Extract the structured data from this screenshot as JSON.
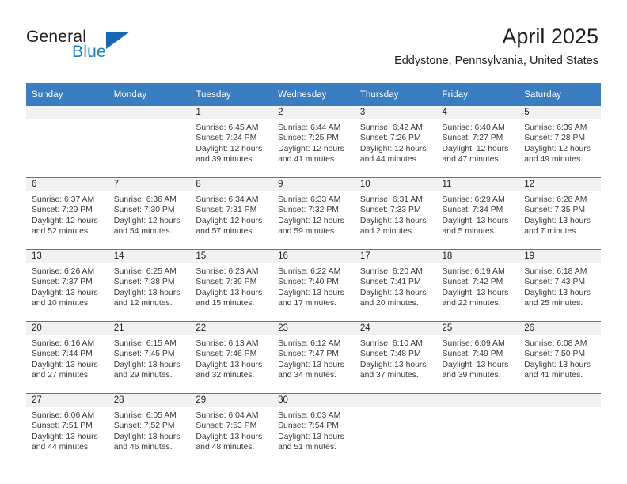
{
  "brand": {
    "name_part1": "General",
    "name_part2": "Blue",
    "accent_color": "#1668b2",
    "text_color": "#231f20"
  },
  "header": {
    "month_title": "April 2025",
    "location": "Eddystone, Pennsylvania, United States"
  },
  "calendar": {
    "header_bg": "#3a7dc0",
    "daynum_bg": "#f1f1f1",
    "weekdays": [
      "Sunday",
      "Monday",
      "Tuesday",
      "Wednesday",
      "Thursday",
      "Friday",
      "Saturday"
    ],
    "weeks": [
      [
        {
          "day": ""
        },
        {
          "day": ""
        },
        {
          "day": "1",
          "sunrise": "Sunrise: 6:45 AM",
          "sunset": "Sunset: 7:24 PM",
          "daylight": "Daylight: 12 hours and 39 minutes."
        },
        {
          "day": "2",
          "sunrise": "Sunrise: 6:44 AM",
          "sunset": "Sunset: 7:25 PM",
          "daylight": "Daylight: 12 hours and 41 minutes."
        },
        {
          "day": "3",
          "sunrise": "Sunrise: 6:42 AM",
          "sunset": "Sunset: 7:26 PM",
          "daylight": "Daylight: 12 hours and 44 minutes."
        },
        {
          "day": "4",
          "sunrise": "Sunrise: 6:40 AM",
          "sunset": "Sunset: 7:27 PM",
          "daylight": "Daylight: 12 hours and 47 minutes."
        },
        {
          "day": "5",
          "sunrise": "Sunrise: 6:39 AM",
          "sunset": "Sunset: 7:28 PM",
          "daylight": "Daylight: 12 hours and 49 minutes."
        }
      ],
      [
        {
          "day": "6",
          "sunrise": "Sunrise: 6:37 AM",
          "sunset": "Sunset: 7:29 PM",
          "daylight": "Daylight: 12 hours and 52 minutes."
        },
        {
          "day": "7",
          "sunrise": "Sunrise: 6:36 AM",
          "sunset": "Sunset: 7:30 PM",
          "daylight": "Daylight: 12 hours and 54 minutes."
        },
        {
          "day": "8",
          "sunrise": "Sunrise: 6:34 AM",
          "sunset": "Sunset: 7:31 PM",
          "daylight": "Daylight: 12 hours and 57 minutes."
        },
        {
          "day": "9",
          "sunrise": "Sunrise: 6:33 AM",
          "sunset": "Sunset: 7:32 PM",
          "daylight": "Daylight: 12 hours and 59 minutes."
        },
        {
          "day": "10",
          "sunrise": "Sunrise: 6:31 AM",
          "sunset": "Sunset: 7:33 PM",
          "daylight": "Daylight: 13 hours and 2 minutes."
        },
        {
          "day": "11",
          "sunrise": "Sunrise: 6:29 AM",
          "sunset": "Sunset: 7:34 PM",
          "daylight": "Daylight: 13 hours and 5 minutes."
        },
        {
          "day": "12",
          "sunrise": "Sunrise: 6:28 AM",
          "sunset": "Sunset: 7:35 PM",
          "daylight": "Daylight: 13 hours and 7 minutes."
        }
      ],
      [
        {
          "day": "13",
          "sunrise": "Sunrise: 6:26 AM",
          "sunset": "Sunset: 7:37 PM",
          "daylight": "Daylight: 13 hours and 10 minutes."
        },
        {
          "day": "14",
          "sunrise": "Sunrise: 6:25 AM",
          "sunset": "Sunset: 7:38 PM",
          "daylight": "Daylight: 13 hours and 12 minutes."
        },
        {
          "day": "15",
          "sunrise": "Sunrise: 6:23 AM",
          "sunset": "Sunset: 7:39 PM",
          "daylight": "Daylight: 13 hours and 15 minutes."
        },
        {
          "day": "16",
          "sunrise": "Sunrise: 6:22 AM",
          "sunset": "Sunset: 7:40 PM",
          "daylight": "Daylight: 13 hours and 17 minutes."
        },
        {
          "day": "17",
          "sunrise": "Sunrise: 6:20 AM",
          "sunset": "Sunset: 7:41 PM",
          "daylight": "Daylight: 13 hours and 20 minutes."
        },
        {
          "day": "18",
          "sunrise": "Sunrise: 6:19 AM",
          "sunset": "Sunset: 7:42 PM",
          "daylight": "Daylight: 13 hours and 22 minutes."
        },
        {
          "day": "19",
          "sunrise": "Sunrise: 6:18 AM",
          "sunset": "Sunset: 7:43 PM",
          "daylight": "Daylight: 13 hours and 25 minutes."
        }
      ],
      [
        {
          "day": "20",
          "sunrise": "Sunrise: 6:16 AM",
          "sunset": "Sunset: 7:44 PM",
          "daylight": "Daylight: 13 hours and 27 minutes."
        },
        {
          "day": "21",
          "sunrise": "Sunrise: 6:15 AM",
          "sunset": "Sunset: 7:45 PM",
          "daylight": "Daylight: 13 hours and 29 minutes."
        },
        {
          "day": "22",
          "sunrise": "Sunrise: 6:13 AM",
          "sunset": "Sunset: 7:46 PM",
          "daylight": "Daylight: 13 hours and 32 minutes."
        },
        {
          "day": "23",
          "sunrise": "Sunrise: 6:12 AM",
          "sunset": "Sunset: 7:47 PM",
          "daylight": "Daylight: 13 hours and 34 minutes."
        },
        {
          "day": "24",
          "sunrise": "Sunrise: 6:10 AM",
          "sunset": "Sunset: 7:48 PM",
          "daylight": "Daylight: 13 hours and 37 minutes."
        },
        {
          "day": "25",
          "sunrise": "Sunrise: 6:09 AM",
          "sunset": "Sunset: 7:49 PM",
          "daylight": "Daylight: 13 hours and 39 minutes."
        },
        {
          "day": "26",
          "sunrise": "Sunrise: 6:08 AM",
          "sunset": "Sunset: 7:50 PM",
          "daylight": "Daylight: 13 hours and 41 minutes."
        }
      ],
      [
        {
          "day": "27",
          "sunrise": "Sunrise: 6:06 AM",
          "sunset": "Sunset: 7:51 PM",
          "daylight": "Daylight: 13 hours and 44 minutes."
        },
        {
          "day": "28",
          "sunrise": "Sunrise: 6:05 AM",
          "sunset": "Sunset: 7:52 PM",
          "daylight": "Daylight: 13 hours and 46 minutes."
        },
        {
          "day": "29",
          "sunrise": "Sunrise: 6:04 AM",
          "sunset": "Sunset: 7:53 PM",
          "daylight": "Daylight: 13 hours and 48 minutes."
        },
        {
          "day": "30",
          "sunrise": "Sunrise: 6:03 AM",
          "sunset": "Sunset: 7:54 PM",
          "daylight": "Daylight: 13 hours and 51 minutes."
        },
        {
          "day": ""
        },
        {
          "day": ""
        },
        {
          "day": ""
        }
      ]
    ]
  }
}
